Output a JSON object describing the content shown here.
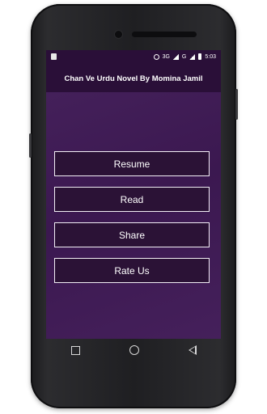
{
  "status_bar": {
    "network": "3G",
    "network2": "G",
    "time": "5:03"
  },
  "app_bar": {
    "title": "Chan Ve Urdu Novel By Momina Jamil"
  },
  "buttons": {
    "resume": "Resume",
    "read": "Read",
    "share": "Share",
    "rate_us": "Rate Us"
  },
  "nav_bar": {
    "back_icon": "back-triangle-icon",
    "home_icon": "home-circle-icon",
    "recent_icon": "recent-apps-square-icon"
  },
  "colors": {
    "status_bar_bg": "#2a0f38",
    "content_bg": "#3d1a51",
    "button_bg": "#2b1236",
    "button_border": "#f2eef5",
    "text": "#ffffff"
  }
}
